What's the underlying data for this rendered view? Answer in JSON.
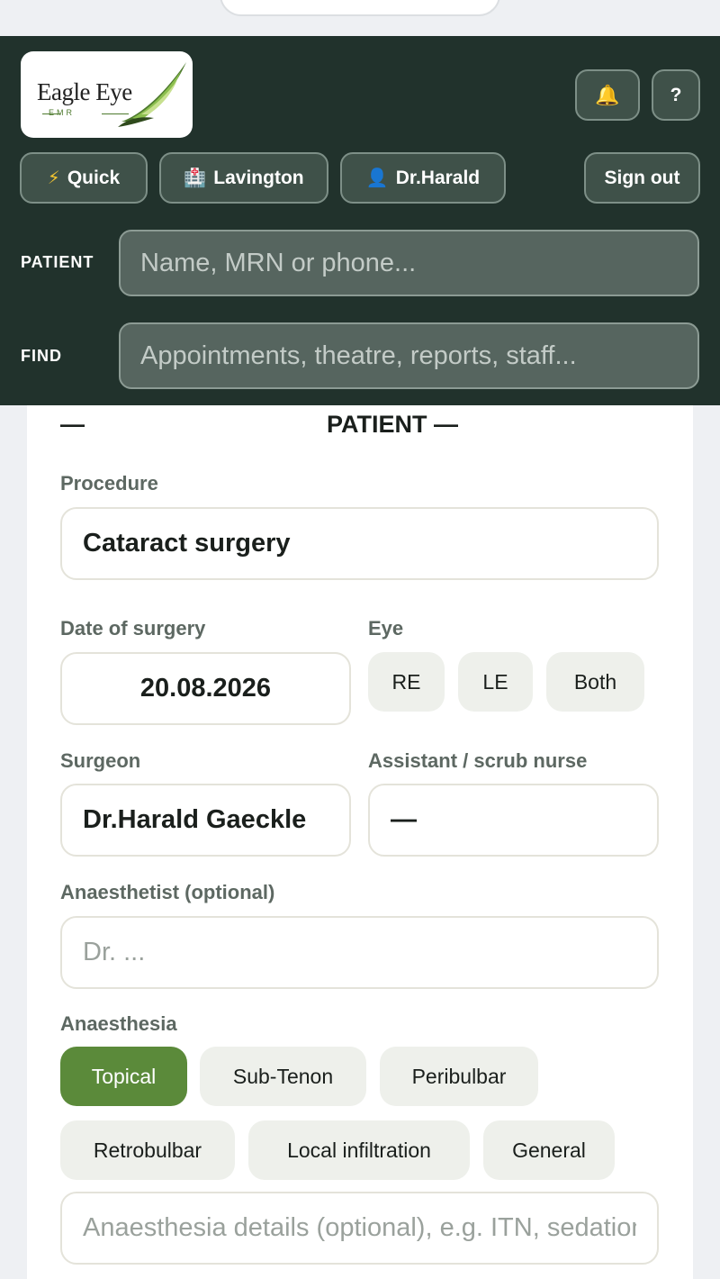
{
  "header": {
    "logo": {
      "name": "Eagle Eye",
      "sub": "EMR"
    },
    "bell_icon": "bell-icon",
    "help_label": "?",
    "quick_label": "Quick",
    "location_label": "Lavington",
    "user_label": "Dr.Harald",
    "signout_label": "Sign out",
    "patient_label": "PATIENT",
    "patient_placeholder": "Name, MRN or phone...",
    "find_label": "FIND",
    "find_placeholder": "Appointments, theatre, reports, staff..."
  },
  "form": {
    "section_left": "—",
    "section_title": "PATIENT —",
    "procedure_label": "Procedure",
    "procedure_value": "Cataract surgery",
    "date_label": "Date of surgery",
    "date_value": "20.08.2026",
    "eye_label": "Eye",
    "eye_options": [
      "RE",
      "LE",
      "Both"
    ],
    "surgeon_label": "Surgeon",
    "surgeon_value": "Dr.Harald Gaeckle",
    "assistant_label": "Assistant / scrub nurse",
    "assistant_value": "—",
    "anaesthetist_label": "Anaesthetist (optional)",
    "anaesthetist_placeholder": "Dr. ...",
    "anaesthesia_label": "Anaesthesia",
    "anaesthesia_options": [
      "Topical",
      "Sub-Tenon",
      "Peribulbar",
      "Retrobulbar",
      "Local infiltration",
      "General"
    ],
    "anaesthesia_selected": "Topical",
    "anaesthesia_details_placeholder": "Anaesthesia details (optional), e.g. ITN, sedation"
  },
  "colors": {
    "header_bg": "#21322c",
    "accent_green": "#5b8a3a",
    "chip_bg": "#eef0eb"
  }
}
